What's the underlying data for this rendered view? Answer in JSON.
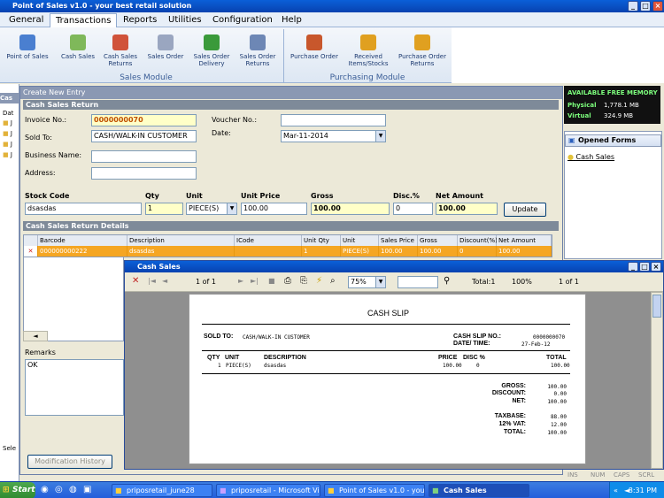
{
  "app": {
    "title": "Point of Sales v1.0 - your best retail solution"
  },
  "menus": [
    "General",
    "Transactions",
    "Reports",
    "Utilities",
    "Configuration",
    "Help"
  ],
  "ribbon": {
    "sales_buttons": [
      "Point of Sales",
      "Cash Sales",
      "Cash Sales Returns",
      "Sales Order",
      "Sales Order Delivery",
      "Sales Order Returns"
    ],
    "sales_group": "Sales Module",
    "purchasing_buttons": [
      "Purchase Order",
      "Received Items/Stocks",
      "Purchase Order Returns"
    ],
    "purchasing_group": "Purchasing Module"
  },
  "form": {
    "title": "Create New Entry",
    "section": "Cash Sales Return",
    "invoice_label": "Invoice No.:",
    "invoice_value": "0000000070",
    "sold_to_label": "Sold To:",
    "sold_to_value": "CASH/WALK-IN CUSTOMER",
    "business_label": "Business Name:",
    "address_label": "Address:",
    "voucher_label": "Voucher No.:",
    "date_label": "Date:",
    "date_value": "Mar-11-2014",
    "line": {
      "stock_code_label": "Stock Code",
      "stock_code_value": "dsasdas",
      "qty_label": "Qty",
      "qty_value": "1",
      "unit_label": "Unit",
      "unit_value": "PIECE(S)",
      "unit_price_label": "Unit Price",
      "unit_price_value": "100.00",
      "gross_label": "Gross",
      "gross_value": "100.00",
      "disc_label": "Disc.%",
      "disc_value": "0",
      "net_label": "Net Amount",
      "net_value": "100.00",
      "update_button": "Update"
    },
    "details_section": "Cash Sales Return Details",
    "columns": [
      "Barcode",
      "Description",
      "ICode",
      "Unit Qty",
      "Unit",
      "Sales Price",
      "Gross",
      "Discount(%)",
      "Net Amount"
    ],
    "row": [
      "000000000222",
      "dsasdas",
      "",
      "1",
      "PIECE(S)",
      "100.00",
      "100.00",
      "0",
      "100.00"
    ],
    "remarks_label": "Remarks",
    "remarks_value": "OK",
    "history_button": "Modification History"
  },
  "memory": {
    "title": "AVAILABLE FREE MEMORY",
    "physical_label": "Physical",
    "physical_value": "1,778.1 MB",
    "virtual_label": "Virtual",
    "virtual_value": "324.9 MB"
  },
  "opened_forms": {
    "title": "Opened Forms",
    "items": [
      "Cash Sales"
    ]
  },
  "report": {
    "title": "Cash Sales",
    "page_indicator": "1 of 1",
    "zoom": "75%",
    "total_label": "Total:1",
    "percent": "100%",
    "page_count": "1 of 1",
    "slip": {
      "heading": "CASH SLIP",
      "sold_to_label": "SOLD TO:",
      "sold_to_value": "CASH/WALK-IN CUSTOMER",
      "slip_no_label": "CASH SLIP NO.:",
      "slip_no_value": "0000000070",
      "datetime_label": "DATE/ TIME:",
      "datetime_value": "27-Feb-12",
      "col_qty": "QTY",
      "col_unit": "UNIT",
      "col_desc": "DESCRIPTION",
      "col_price": "PRICE",
      "col_disc": "DISC %",
      "col_total": "TOTAL",
      "item_qty": "1",
      "item_unit": "PIECE(S)",
      "item_desc": "dsasdas",
      "item_price": "100.00",
      "item_disc": "0",
      "item_total": "100.00",
      "gross_label": "GROSS:",
      "gross_value": "100.00",
      "discount_label": "DISCOUNT:",
      "discount_value": "0.00",
      "net_label": "NET:",
      "net_value": "100.00",
      "taxbase_label": "TAXBASE:",
      "taxbase_value": "88.00",
      "vat_label": "12% VAT:",
      "vat_value": "12.00",
      "total_label": "TOTAL:",
      "total_value": "100.00"
    }
  },
  "left_pane": {
    "label": "Cas",
    "date_label": "Dat",
    "items": [
      "J",
      "J",
      "J",
      "J"
    ]
  },
  "statusbar": {
    "left": "Sele",
    "items": [
      "INS",
      "NUM",
      "CAPS",
      "SCRL"
    ]
  },
  "taskbar": {
    "start": "Start",
    "tasks": [
      "priposretail_june28",
      "priposretail - Microsoft Vi...",
      "Point of Sales v1.0 - you...",
      "Cash Sales"
    ],
    "time": "8:31 PM"
  }
}
